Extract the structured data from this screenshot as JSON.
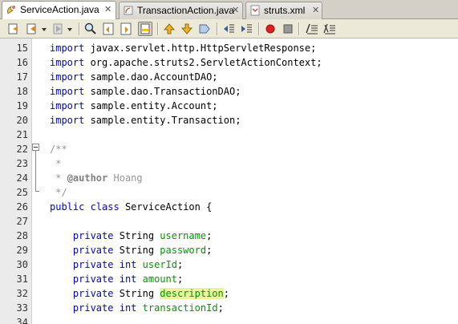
{
  "tabs": [
    {
      "label": "ServiceAction.java",
      "close": "✕",
      "icon": "java-file-icon"
    },
    {
      "label": "TransactionAction.java",
      "close": "✕",
      "icon": "java-file-icon"
    },
    {
      "label": "struts.xml",
      "close": "✕",
      "icon": "xml-file-icon"
    }
  ],
  "toolbar": {
    "buttons": [
      "last-edit-icon",
      "back-icon",
      "forward-icon",
      "find-selection-icon",
      "find-previous-icon",
      "find-next-icon",
      "toggle-highlight-icon",
      "previous-bookmark-icon",
      "next-bookmark-icon",
      "toggle-bookmark-icon",
      "shift-left-icon",
      "shift-right-icon",
      "start-macro-icon",
      "stop-macro-icon",
      "comment-icon"
    ]
  },
  "lines": [
    {
      "num": "15",
      "parts": [
        {
          "t": "import",
          "c": "kw"
        },
        {
          "t": " javax.servlet.http.HttpServletResponse;"
        }
      ]
    },
    {
      "num": "16",
      "parts": [
        {
          "t": "import",
          "c": "kw"
        },
        {
          "t": " org.apache.struts2.ServletActionContext;"
        }
      ]
    },
    {
      "num": "17",
      "parts": [
        {
          "t": "import",
          "c": "kw"
        },
        {
          "t": " sample.dao.AccountDAO;"
        }
      ]
    },
    {
      "num": "18",
      "parts": [
        {
          "t": "import",
          "c": "kw"
        },
        {
          "t": " sample.dao.TransactionDAO;"
        }
      ]
    },
    {
      "num": "19",
      "parts": [
        {
          "t": "import",
          "c": "kw"
        },
        {
          "t": " sample.entity.Account;"
        }
      ]
    },
    {
      "num": "20",
      "parts": [
        {
          "t": "import",
          "c": "kw"
        },
        {
          "t": " sample.entity.Transaction;"
        }
      ]
    },
    {
      "num": "21",
      "parts": []
    },
    {
      "num": "22",
      "parts": [
        {
          "t": "/**",
          "c": "cm"
        }
      ]
    },
    {
      "num": "23",
      "parts": [
        {
          "t": " *",
          "c": "cm"
        }
      ]
    },
    {
      "num": "24",
      "parts": [
        {
          "t": " * ",
          "c": "cm"
        },
        {
          "t": "@author",
          "c": "at"
        },
        {
          "t": " Hoang",
          "c": "cm"
        }
      ]
    },
    {
      "num": "25",
      "parts": [
        {
          "t": " */",
          "c": "cm"
        }
      ]
    },
    {
      "num": "26",
      "parts": [
        {
          "t": "public",
          "c": "kw"
        },
        {
          "t": " "
        },
        {
          "t": "class",
          "c": "kw"
        },
        {
          "t": " ServiceAction {"
        }
      ]
    },
    {
      "num": "27",
      "parts": []
    },
    {
      "num": "28",
      "parts": [
        {
          "t": "    "
        },
        {
          "t": "private",
          "c": "kw"
        },
        {
          "t": " String "
        },
        {
          "t": "username",
          "c": "fld"
        },
        {
          "t": ";"
        }
      ]
    },
    {
      "num": "29",
      "parts": [
        {
          "t": "    "
        },
        {
          "t": "private",
          "c": "kw"
        },
        {
          "t": " String "
        },
        {
          "t": "password",
          "c": "fld"
        },
        {
          "t": ";"
        }
      ]
    },
    {
      "num": "30",
      "parts": [
        {
          "t": "    "
        },
        {
          "t": "private",
          "c": "kw"
        },
        {
          "t": " "
        },
        {
          "t": "int",
          "c": "kw"
        },
        {
          "t": " "
        },
        {
          "t": "userId",
          "c": "fld"
        },
        {
          "t": ";"
        }
      ]
    },
    {
      "num": "31",
      "parts": [
        {
          "t": "    "
        },
        {
          "t": "private",
          "c": "kw"
        },
        {
          "t": " "
        },
        {
          "t": "int",
          "c": "kw"
        },
        {
          "t": " "
        },
        {
          "t": "amount",
          "c": "fld"
        },
        {
          "t": ";"
        }
      ]
    },
    {
      "num": "32",
      "parts": [
        {
          "t": "    "
        },
        {
          "t": "private",
          "c": "kw"
        },
        {
          "t": " String "
        },
        {
          "t": "description",
          "c": "fld hl"
        },
        {
          "t": ";"
        }
      ]
    },
    {
      "num": "33",
      "parts": [
        {
          "t": "    "
        },
        {
          "t": "private",
          "c": "kw"
        },
        {
          "t": " "
        },
        {
          "t": "int",
          "c": "kw"
        },
        {
          "t": " "
        },
        {
          "t": "transactionId",
          "c": "fld"
        },
        {
          "t": ";"
        }
      ]
    },
    {
      "num": "34",
      "parts": []
    }
  ]
}
